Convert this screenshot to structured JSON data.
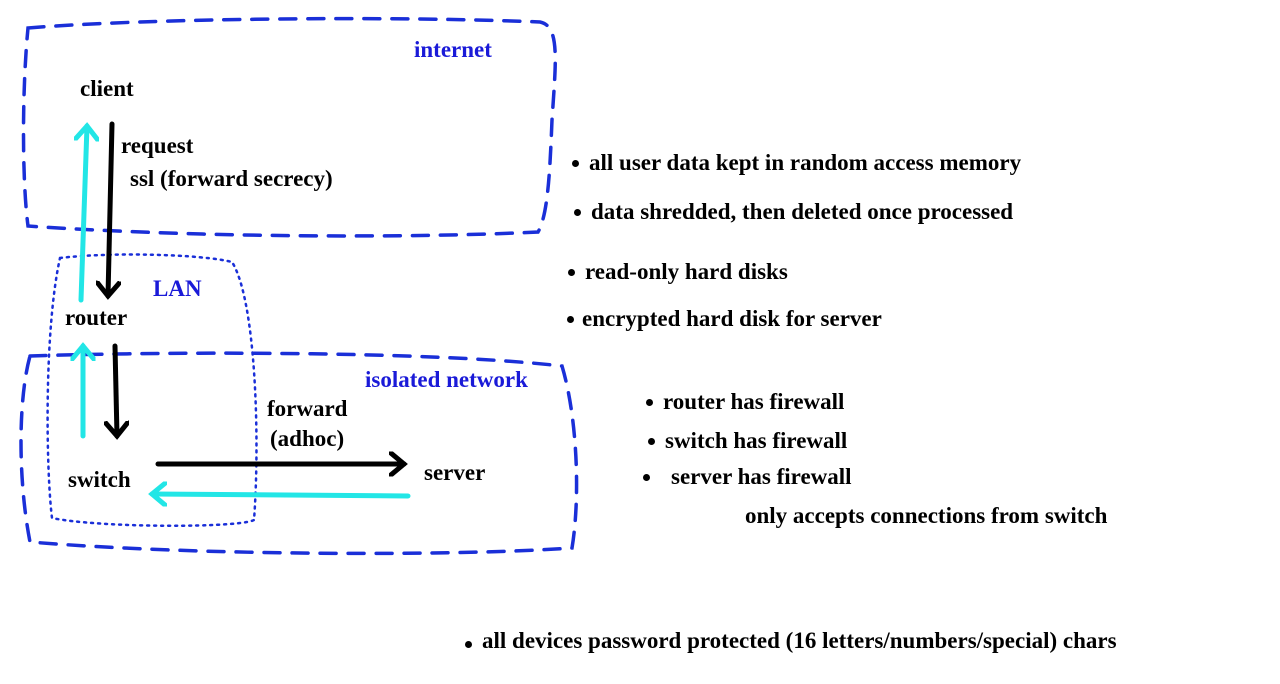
{
  "colors": {
    "zone_border": "#1a2fd8",
    "zone_label": "#1a1ad8",
    "request_arrow": "#000000",
    "response_arrow": "#22e6e6"
  },
  "zones": {
    "internet": "internet",
    "lan": "LAN",
    "isolated": "isolated network"
  },
  "nodes": {
    "client": "client",
    "router": "router",
    "switch": "switch",
    "server": "server"
  },
  "edge_labels": {
    "request": "request",
    "ssl": "ssl (forward secrecy)",
    "forward": "forward",
    "adhoc": "(adhoc)"
  },
  "notes": {
    "ram": "all user data kept in random access memory",
    "shredded": "data shredded, then deleted once processed",
    "readonly": "read-only hard disks",
    "encrypted": "encrypted hard disk for server",
    "router_fw": "router has firewall",
    "switch_fw": "switch has firewall",
    "server_fw": "server has firewall",
    "server_fw_detail": "only accepts connections from switch",
    "passwords": "all devices password protected (16 letters/numbers/special) chars"
  }
}
